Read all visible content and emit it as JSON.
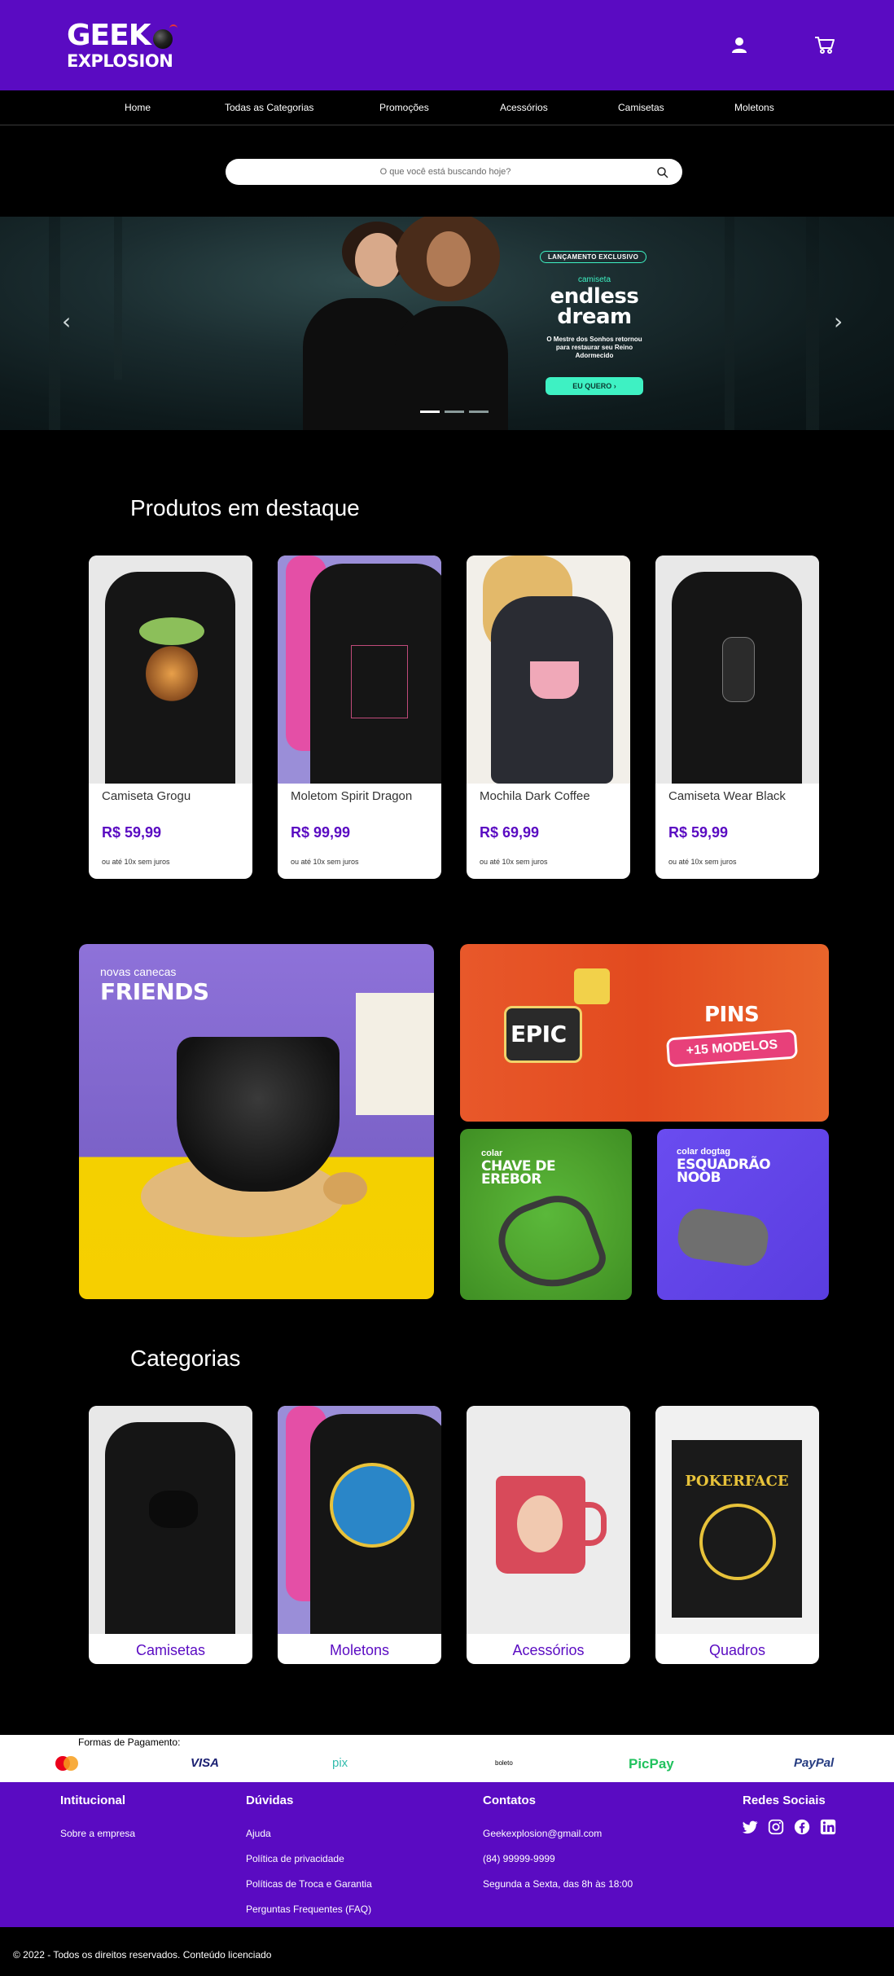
{
  "header": {
    "logo_line1": "GEEK",
    "logo_line2": "EXPLOSION",
    "icons": [
      "user-icon",
      "cart-icon"
    ]
  },
  "nav": {
    "items": [
      "Home",
      "Todas as Categorias",
      "Promoções",
      "Acessórios",
      "Camisetas",
      "Moletons"
    ]
  },
  "search": {
    "placeholder": "O que você está buscando hoje?"
  },
  "hero": {
    "tag": "LANÇAMENTO EXCLUSIVO",
    "subtitle": "camiseta",
    "title": "endless dream",
    "description": "O Mestre dos Sonhos retornou para restaurar seu Reino Adormecido",
    "cta": "EU QUERO ›",
    "prev": "‹",
    "next": "›",
    "slides": 3,
    "active_slide": 1
  },
  "featured": {
    "title": "Produtos em destaque",
    "products": [
      {
        "name": "Camiseta Grogu",
        "price": "R$ 59,99",
        "installments": "ou até 10x sem juros"
      },
      {
        "name": "Moletom Spirit Dragon",
        "price": "R$ 99,99",
        "installments": "ou até 10x sem juros"
      },
      {
        "name": "Mochila Dark Coffee",
        "price": "R$ 69,99",
        "installments": "ou até 10x sem juros"
      },
      {
        "name": "Camiseta Wear Black",
        "price": "R$ 59,99",
        "installments": "ou até 10x sem juros"
      }
    ]
  },
  "banners": {
    "friends_small": "novas canecas",
    "friends_big": "FRIENDS",
    "pins_big": "PINS",
    "pins_badge": "+15 MODELOS",
    "pins_epic": "EPIC",
    "key_small": "colar",
    "key_big": "CHAVE DE EREBOR",
    "noob_small": "colar dogtag",
    "noob_big": "ESQUADRÃO NOOB"
  },
  "categories": {
    "title": "Categorias",
    "items": [
      "Camisetas",
      "Moletons",
      "Acessórios",
      "Quadros"
    ],
    "poster_text": "POKERFACE"
  },
  "payment": {
    "label": "Formas de Pagamento:",
    "methods": [
      "VISA",
      "pix",
      "boleto",
      "PicPay",
      "PayPal"
    ]
  },
  "footer": {
    "institutional": {
      "title": "Intitucional",
      "links": [
        "Sobre a empresa"
      ]
    },
    "doubts": {
      "title": "Dúvidas",
      "links": [
        "Ajuda",
        "Política de privacidade",
        "Políticas de Troca e Garantia",
        "Perguntas Frequentes (FAQ)"
      ]
    },
    "contacts": {
      "title": "Contatos",
      "lines": [
        "Geekexplosion@gmail.com",
        "(84) 99999-9999",
        "Segunda a Sexta, das 8h às 18:00"
      ]
    },
    "social": {
      "title": "Redes Sociais",
      "icons": [
        "twitter-icon",
        "instagram-icon",
        "facebook-icon",
        "linkedin-icon"
      ]
    },
    "copyright": "© 2022 - Todos os direitos reservados. Conteúdo licenciado"
  },
  "colors": {
    "brand": "#5a0bc2",
    "accent": "#3ef1c3"
  }
}
